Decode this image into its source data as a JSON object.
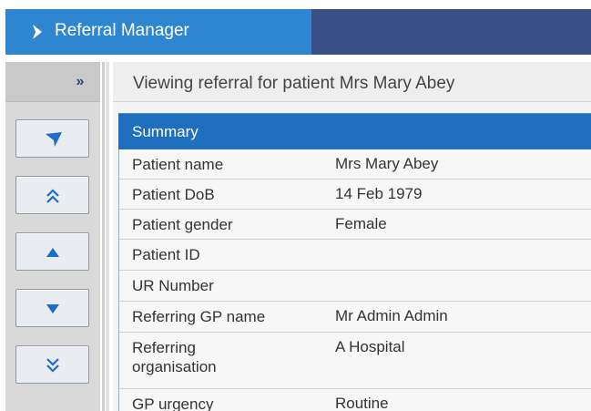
{
  "app": {
    "title": "Referral Manager"
  },
  "rail": {
    "collapse_label": "»",
    "buttons": [
      {
        "name": "send-button",
        "icon": "send-icon"
      },
      {
        "name": "move-top-button",
        "icon": "chevron-double-up-icon"
      },
      {
        "name": "move-up-button",
        "icon": "triangle-up-icon"
      },
      {
        "name": "move-down-button",
        "icon": "triangle-down-icon"
      },
      {
        "name": "move-bottom-button",
        "icon": "chevron-double-down-icon"
      }
    ]
  },
  "header": {
    "viewing_text": "Viewing referral for patient Mrs Mary Abey"
  },
  "summary": {
    "title": "Summary",
    "rows": [
      {
        "label": "Patient name",
        "value": "Mrs Mary Abey"
      },
      {
        "label": "Patient DoB",
        "value": "14 Feb 1979"
      },
      {
        "label": "Patient gender",
        "value": "Female"
      },
      {
        "label": "Patient ID",
        "value": ""
      },
      {
        "label": "UR Number",
        "value": ""
      },
      {
        "label": "Referring GP name",
        "value": "Mr Admin Admin"
      },
      {
        "label": "Referring organisation",
        "value": "A Hospital"
      },
      {
        "label": "GP urgency",
        "value": "Routine"
      }
    ]
  },
  "colors": {
    "title_tab": "#2e86d1",
    "title_bar": "#3a4f86",
    "summary_header": "#1f6fbe",
    "icon": "#1c6ec6"
  }
}
